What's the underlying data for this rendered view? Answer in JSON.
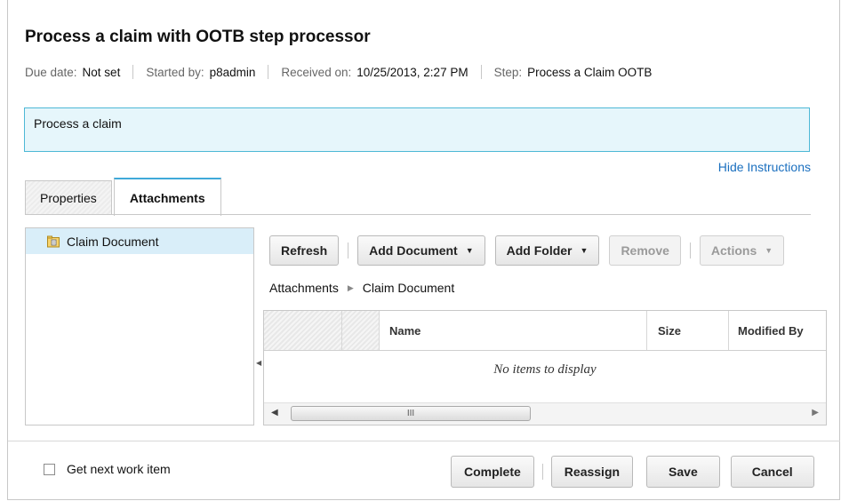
{
  "header": {
    "title": "Process a claim with OOTB step processor",
    "meta": [
      {
        "label": "Due date:",
        "value": "Not set"
      },
      {
        "label": "Started by:",
        "value": "p8admin"
      },
      {
        "label": "Received on:",
        "value": "10/25/2013, 2:27 PM"
      },
      {
        "label": "Step:",
        "value": "Process a Claim OOTB"
      }
    ]
  },
  "instructions": {
    "text": "Process a claim",
    "hide_link": "Hide Instructions"
  },
  "tabs": [
    {
      "label": "Properties",
      "active": false
    },
    {
      "label": "Attachments",
      "active": true
    }
  ],
  "tree": {
    "items": [
      {
        "label": "Claim Document",
        "icon": "folder-attachment-icon",
        "selected": true
      }
    ]
  },
  "toolbar": {
    "refresh": "Refresh",
    "add_document": "Add Document",
    "add_folder": "Add Folder",
    "remove": "Remove",
    "actions": "Actions"
  },
  "breadcrumb": {
    "items": [
      "Attachments",
      "Claim Document"
    ]
  },
  "grid": {
    "columns": [
      "",
      "",
      "Name",
      "Size",
      "Modified By"
    ],
    "empty_message": "No items to display",
    "scroll_thumb": "III"
  },
  "footer": {
    "checkbox_label": "Get next work item",
    "checkbox_checked": false,
    "complete": "Complete",
    "reassign": "Reassign",
    "save": "Save",
    "cancel": "Cancel"
  },
  "colors": {
    "accent": "#3fa9d9",
    "instructions_bg": "#e6f6fb",
    "link": "#1a6fbf",
    "selection": "#d9eef9"
  }
}
